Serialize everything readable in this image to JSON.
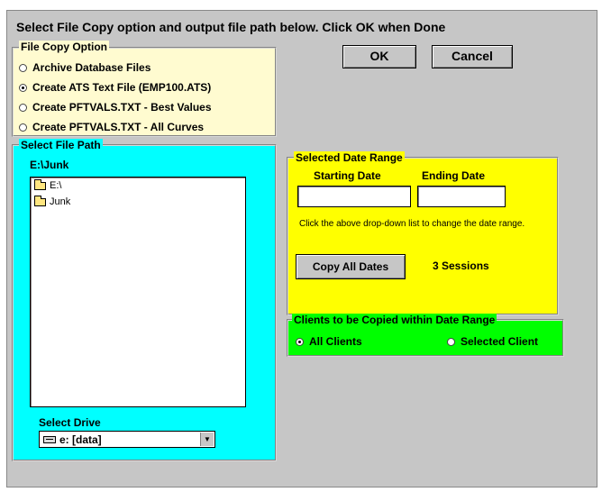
{
  "instructions": "Select File Copy option and output file path below.  Click OK when Done",
  "buttons": {
    "ok": "OK",
    "cancel": "Cancel",
    "copy_all_dates": "Copy All Dates"
  },
  "file_copy_option": {
    "legend": "File Copy Option",
    "options": [
      {
        "label": "Archive Database Files",
        "selected": false
      },
      {
        "label": "Create ATS Text File (EMP100.ATS)",
        "selected": true
      },
      {
        "label": "Create PFTVALS.TXT - Best Values",
        "selected": false
      },
      {
        "label": "Create PFTVALS.TXT - All Curves",
        "selected": false
      }
    ]
  },
  "file_path": {
    "legend": "Select File Path",
    "current_path": "E:\\Junk",
    "folders": [
      "E:\\",
      "Junk"
    ],
    "drive_label": "Select Drive",
    "drive_value": "e: [data]"
  },
  "date_range": {
    "legend": "Selected Date Range",
    "start_label": "Starting Date",
    "end_label": "Ending Date",
    "start_value": "",
    "end_value": "",
    "hint": "Click the above drop-down list to change the date range.",
    "sessions": "3 Sessions"
  },
  "clients": {
    "legend": "Clients to be Copied within Date Range",
    "options": [
      {
        "label": "All Clients",
        "selected": true
      },
      {
        "label": "Selected Client",
        "selected": false
      }
    ]
  },
  "colors": {
    "dialog_bg": "#c6c6c6",
    "file_copy_bg": "#fffbd0",
    "file_path_bg": "#00ffff",
    "date_range_bg": "#ffff00",
    "clients_bg": "#00ff00"
  }
}
